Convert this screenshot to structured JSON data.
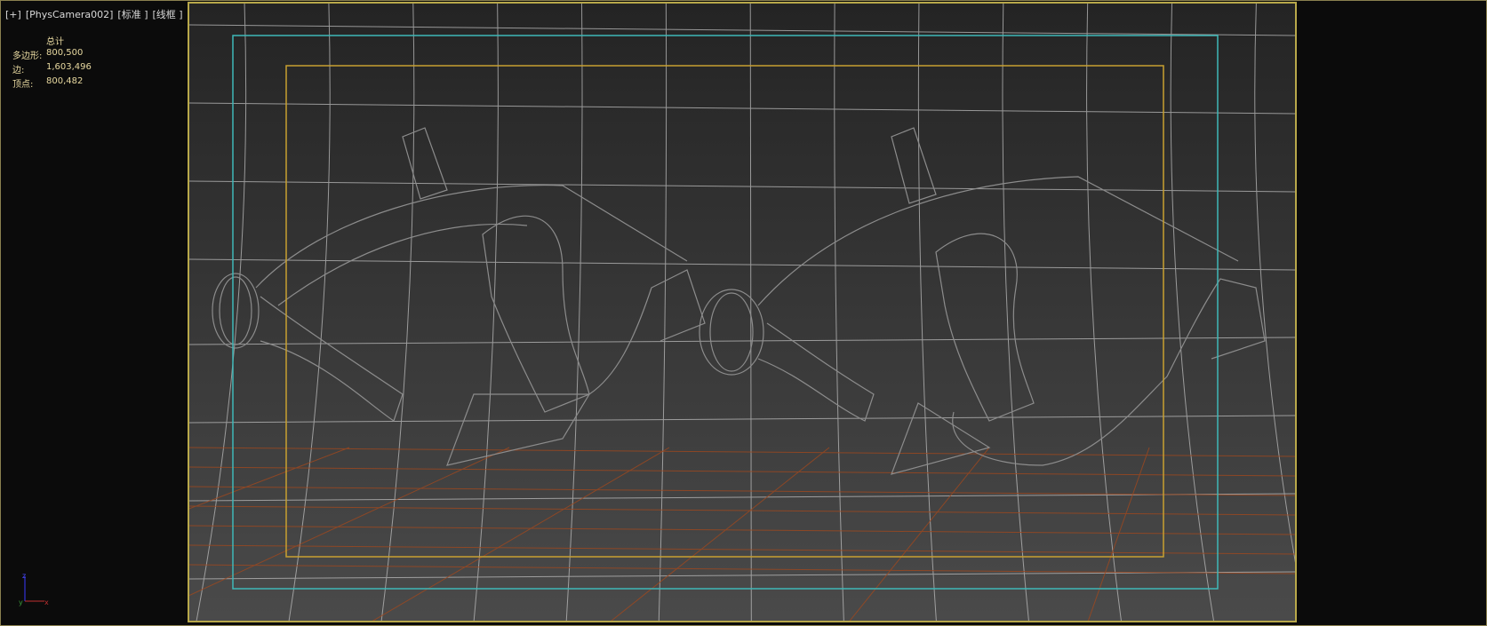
{
  "viewport_label": {
    "plus": "[+]",
    "camera": "[PhysCamera002]",
    "shading": "[标准 ]",
    "mode": "[线框 ]"
  },
  "stats": {
    "header": "总计",
    "rows": [
      {
        "label": "多边形:",
        "value": "800,500"
      },
      {
        "label": "边:",
        "value": "1,603,496"
      },
      {
        "label": "顶点:",
        "value": "800,482"
      }
    ]
  },
  "gizmo": {
    "z": "z",
    "y": "y",
    "x": "x"
  },
  "colors": {
    "safe_frame": "#3fb8b8",
    "render_frame": "#c8a030",
    "grid": "#c8c8c8",
    "ground_grid": "#a04a20",
    "wire": "#8a8a8a"
  }
}
